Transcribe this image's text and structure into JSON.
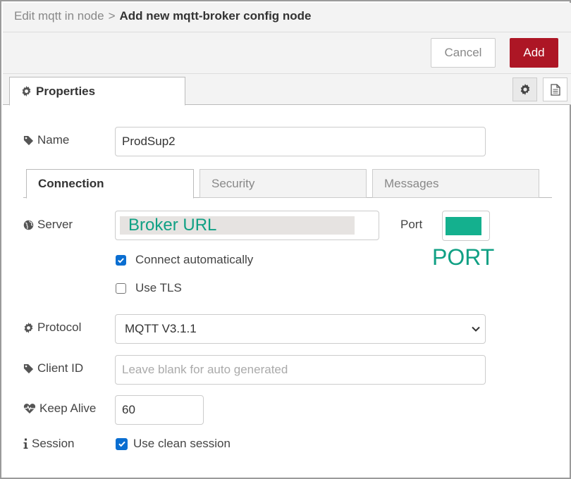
{
  "header": {
    "breadcrumb_parent": "Edit mqtt in node",
    "separator": ">",
    "title": "Add new mqtt-broker config node"
  },
  "buttons": {
    "cancel": "Cancel",
    "add": "Add",
    "add_color": "#ad1625"
  },
  "tabs": {
    "properties": "Properties"
  },
  "form": {
    "name": {
      "label": "Name",
      "value": "ProdSup2"
    },
    "subtabs": [
      "Connection",
      "Security",
      "Messages"
    ],
    "server": {
      "label": "Server",
      "overlay_text": "Broker URL"
    },
    "port": {
      "label": "Port",
      "annotation": "PORT",
      "annotation_color": "#10a084"
    },
    "connect_auto": {
      "label": "Connect automatically",
      "checked": true
    },
    "use_tls": {
      "label": "Use TLS",
      "checked": false
    },
    "protocol": {
      "label": "Protocol",
      "value": "MQTT V3.1.1"
    },
    "client_id": {
      "label": "Client ID",
      "placeholder": "Leave blank for auto generated"
    },
    "keep_alive": {
      "label": "Keep Alive",
      "value": "60"
    },
    "session": {
      "label": "Session",
      "option": "Use clean session",
      "checked": true
    }
  },
  "icons": [
    "gear-icon",
    "document-icon",
    "tag-icon",
    "globe-icon",
    "heartbeat-icon",
    "info-icon",
    "chevron-down-icon",
    "checkmark-icon"
  ]
}
